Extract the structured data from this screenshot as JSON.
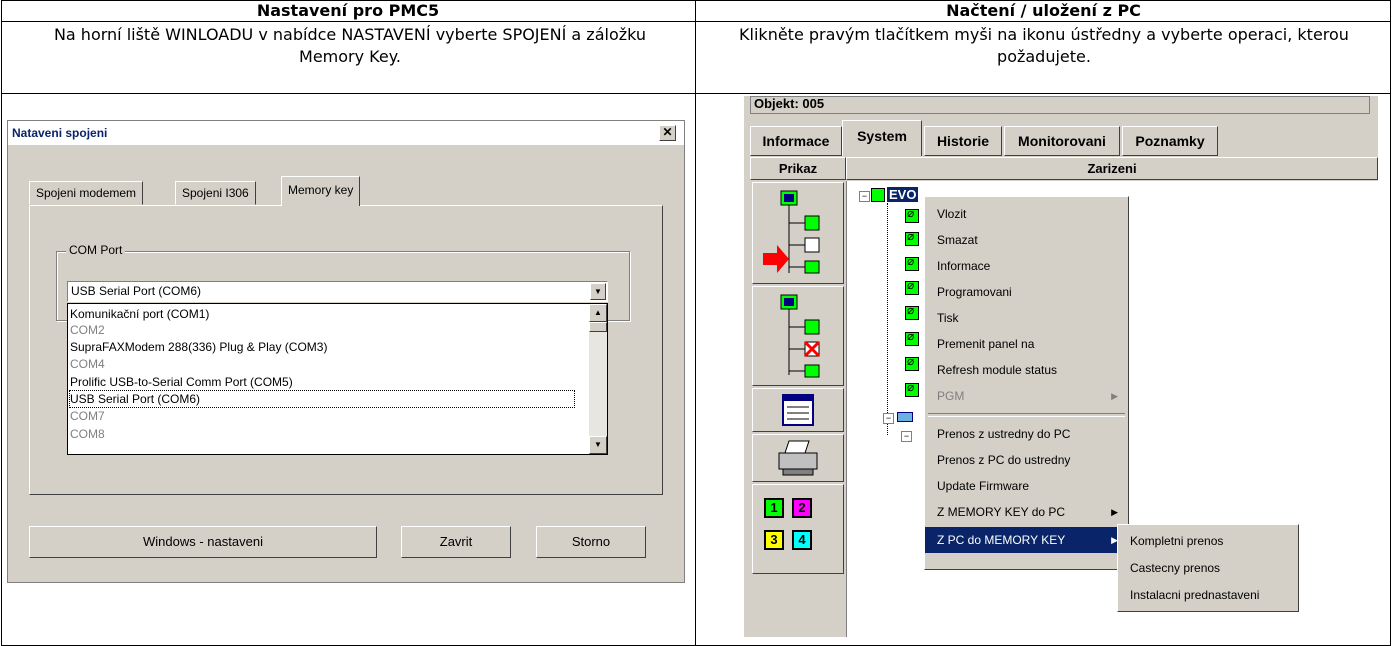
{
  "left": {
    "header": "Nastavení pro PMC5",
    "description": "Na horní liště WINLOADU v nabídce NASTAVENÍ vyberte SPOJENÍ a záložku Memory Key.",
    "dialog": {
      "title": "Nataveni spojeni",
      "tabs": [
        "Spojeni modemem",
        "Spojeni I306",
        "Memory key"
      ],
      "group_label": "COM Port",
      "combo_value": "USB Serial Port (COM6)",
      "options": [
        {
          "label": "Komunikační port (COM1)",
          "enabled": true
        },
        {
          "label": "COM2",
          "enabled": false
        },
        {
          "label": "SupraFAXModem 288(336) Plug & Play (COM3)",
          "enabled": true
        },
        {
          "label": "COM4",
          "enabled": false
        },
        {
          "label": "Prolific USB-to-Serial Comm Port (COM5)",
          "enabled": true
        },
        {
          "label": "USB Serial Port (COM6)",
          "enabled": true
        },
        {
          "label": "COM7",
          "enabled": false
        },
        {
          "label": "COM8",
          "enabled": false
        }
      ],
      "buttons": {
        "windows": "Windows - nastaveni",
        "close": "Zavrit",
        "cancel": "Storno"
      }
    }
  },
  "right": {
    "header": "Načtení / uložení z PC",
    "description": "Klikněte pravým tlačítkem myši na ikonu ústředny a vyberte operaci, kterou požadujete.",
    "app": {
      "object_line": "Objekt: 005",
      "tabs": [
        "Informace",
        "System",
        "Historie",
        "Monitorovani",
        "Poznamky"
      ],
      "col_headers": {
        "command": "Prikaz",
        "device": "Zarizeni"
      },
      "tree_root": "EVO",
      "numbers": [
        "1",
        "2",
        "3",
        "4"
      ],
      "context_menu": [
        "Vlozit",
        "Smazat",
        "Informace",
        "Programovani",
        "Tisk",
        "Premenit panel na",
        "Refresh module status",
        "PGM",
        "Prenos z ustredny do PC",
        "Prenos z PC do ustredny",
        "Update Firmware",
        "Z MEMORY KEY do PC",
        "Z PC do MEMORY KEY"
      ],
      "submenu": [
        "Kompletni prenos",
        "Castecny prenos",
        "Instalacni prednastaveni"
      ]
    }
  }
}
